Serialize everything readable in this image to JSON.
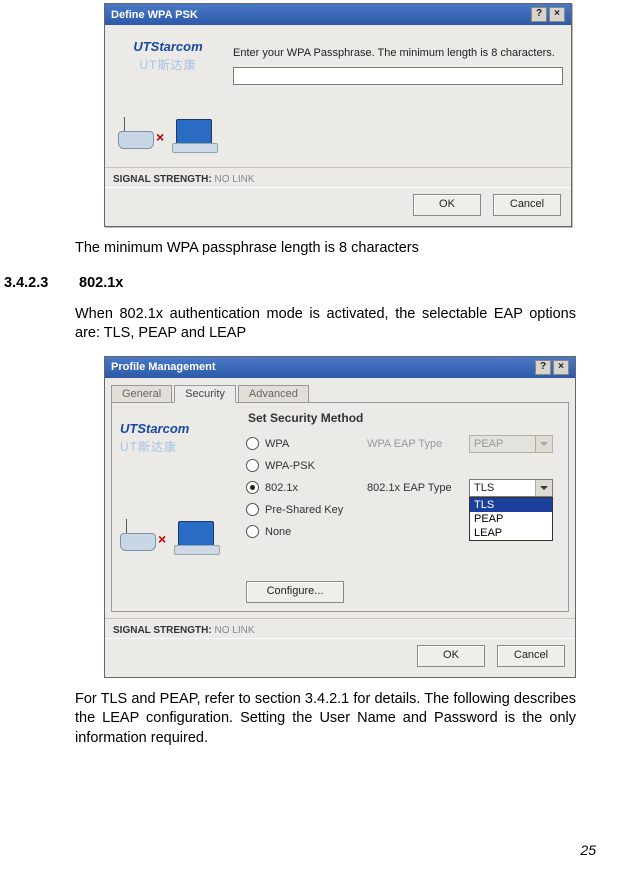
{
  "dialog1": {
    "title": "Define WPA PSK",
    "brand_en": "UTStarcom",
    "brand_cn": "UT斯达康",
    "instruction": "Enter your WPA Passphrase.  The minimum length is 8 characters.",
    "passphrase_value": "",
    "signal_label": "SIGNAL STRENGTH:",
    "signal_value": "NO LINK",
    "ok": "OK",
    "cancel": "Cancel",
    "help_glyph": "?",
    "close_glyph": "×"
  },
  "caption1": "The minimum WPA passphrase length is 8 characters",
  "section_num": "3.4.2.3",
  "section_title": "802.1x",
  "para1": "When 802.1x authentication mode is activated, the selectable EAP options are: TLS, PEAP and LEAP",
  "dialog2": {
    "title": "Profile Management",
    "tabs": {
      "general": "General",
      "security": "Security",
      "advanced": "Advanced"
    },
    "brand_en": "UTStarcom",
    "brand_cn": "UT斯达康",
    "heading": "Set Security Method",
    "opts": {
      "wpa": "WPA",
      "wpa_psk": "WPA-PSK",
      "dot1x": "802.1x",
      "psk": "Pre-Shared Key",
      "none": "None"
    },
    "wpa_eap_label": "WPA EAP Type",
    "wpa_eap_value": "PEAP",
    "dot1x_eap_label": "802.1x EAP Type",
    "dot1x_eap_value": "TLS",
    "dd_items": [
      "TLS",
      "PEAP",
      "LEAP"
    ],
    "configure": "Configure...",
    "signal_label": "SIGNAL STRENGTH:",
    "signal_value": "NO LINK",
    "ok": "OK",
    "cancel": "Cancel",
    "help_glyph": "?",
    "close_glyph": "×"
  },
  "para2": "For TLS and PEAP, refer to section 3.4.2.1 for details. The following describes the LEAP configuration. Setting the User Name and Password is the only information required.",
  "page_number": "25"
}
